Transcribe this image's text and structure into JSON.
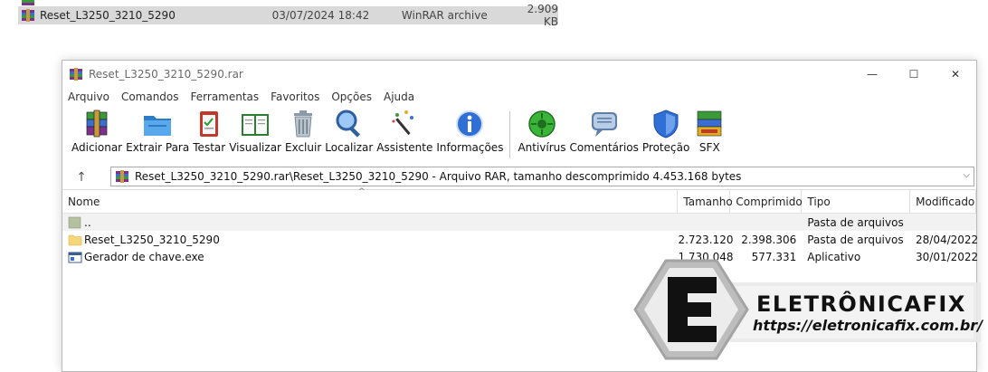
{
  "explorer": {
    "rows": [
      {
        "name": "Reset_L3250_3210_5290",
        "date": "03/07/2024 18:42",
        "type": "WinRAR archive",
        "size": "2.909 KB"
      }
    ]
  },
  "window": {
    "title": "Reset_L3250_3210_5290.rar",
    "controls": {
      "minimize": "—",
      "maximize": "☐",
      "close": "✕"
    }
  },
  "menu": [
    "Arquivo",
    "Comandos",
    "Ferramentas",
    "Favoritos",
    "Opções",
    "Ajuda"
  ],
  "toolbar": {
    "buttons": [
      {
        "label": "Adicionar",
        "icon": "add-archive-icon"
      },
      {
        "label": "Extrair Para",
        "icon": "extract-folder-icon"
      },
      {
        "label": "Testar",
        "icon": "test-clipboard-icon"
      },
      {
        "label": "Visualizar",
        "icon": "view-book-icon"
      },
      {
        "label": "Excluir",
        "icon": "trash-icon"
      },
      {
        "label": "Localizar",
        "icon": "magnifier-icon"
      },
      {
        "label": "Assistente",
        "icon": "wizard-wand-icon"
      },
      {
        "label": "Informações",
        "icon": "info-icon"
      },
      {
        "label": "Antivírus",
        "icon": "antivirus-icon"
      },
      {
        "label": "Comentários",
        "icon": "comment-icon"
      },
      {
        "label": "Proteção",
        "icon": "shield-icon"
      },
      {
        "label": "SFX",
        "icon": "sfx-icon"
      }
    ]
  },
  "address": {
    "up": "↑",
    "path": "Reset_L3250_3210_5290.rar\\Reset_L3250_3210_5290 - Arquivo RAR, tamanho descomprimido 4.453.168 bytes",
    "dropdown": "⌵"
  },
  "filelist": {
    "sort_arrow": "^",
    "columns": [
      "Nome",
      "Tamanho",
      "Comprimido",
      "Tipo",
      "Modificado"
    ],
    "rows": [
      {
        "name": "..",
        "size": "",
        "packed": "",
        "type": "Pasta de arquivos",
        "modified": ""
      },
      {
        "name": "Reset_L3250_3210_5290",
        "size": "2.723.120",
        "packed": "2.398.306",
        "type": "Pasta de arquivos",
        "modified": "28/04/2022"
      },
      {
        "name": "Gerador de chave.exe",
        "size": "1.730.048",
        "packed": "577.331",
        "type": "Aplicativo",
        "modified": "30/01/2022"
      }
    ]
  },
  "watermark": {
    "name": "ELETRÔNICAFIX",
    "url": "https://eletronicafix.com.br/"
  },
  "colors": {
    "folder": "#f5d67a",
    "selection": "#d9d9d9",
    "info_blue": "#2f6fd6",
    "antivirus_green": "#3ab53a"
  }
}
